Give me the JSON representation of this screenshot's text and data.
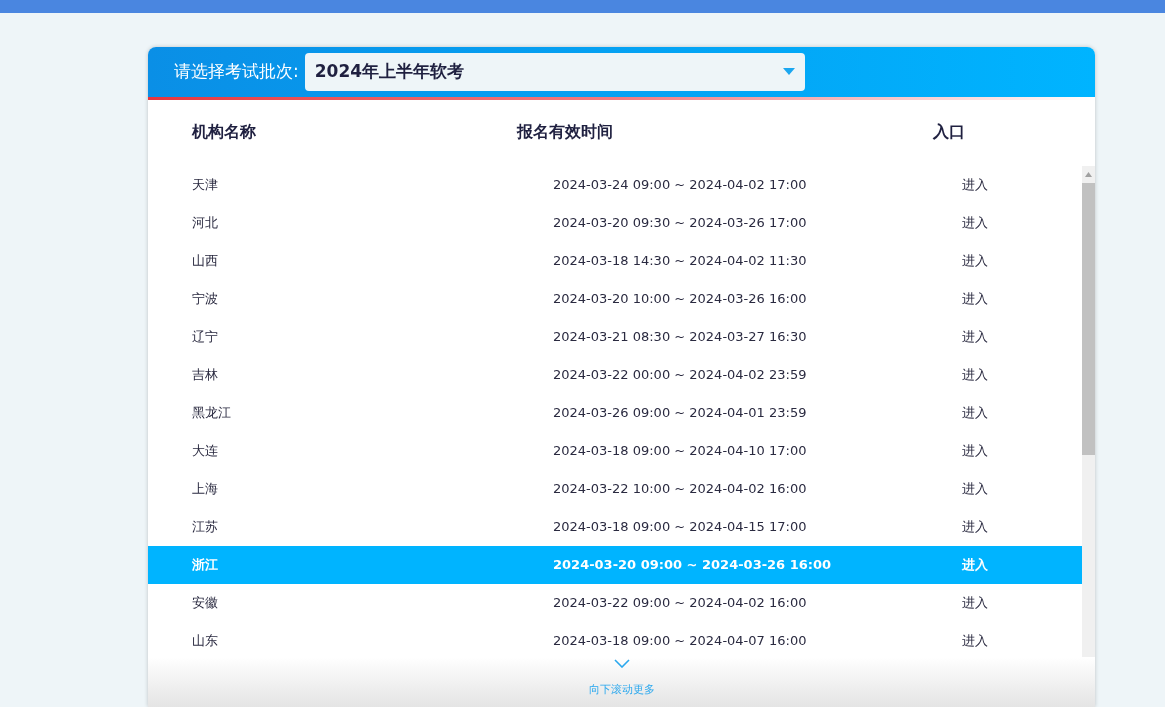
{
  "batch_select": {
    "label": "请选择考试批次:",
    "value": "2024年上半年软考"
  },
  "table": {
    "columns": [
      "机构名称",
      "报名有效时间",
      "入口"
    ],
    "rows": [
      {
        "name": "天津",
        "time": "2024-03-24 09:00 ~ 2024-04-02 17:00",
        "entry": "进入",
        "selected": false
      },
      {
        "name": "河北",
        "time": "2024-03-20 09:30 ~ 2024-03-26 17:00",
        "entry": "进入",
        "selected": false
      },
      {
        "name": "山西",
        "time": "2024-03-18 14:30 ~ 2024-04-02 11:30",
        "entry": "进入",
        "selected": false
      },
      {
        "name": "宁波",
        "time": "2024-03-20 10:00 ~ 2024-03-26 16:00",
        "entry": "进入",
        "selected": false
      },
      {
        "name": "辽宁",
        "time": "2024-03-21 08:30 ~ 2024-03-27 16:30",
        "entry": "进入",
        "selected": false
      },
      {
        "name": "吉林",
        "time": "2024-03-22 00:00 ~ 2024-04-02 23:59",
        "entry": "进入",
        "selected": false
      },
      {
        "name": "黑龙江",
        "time": "2024-03-26 09:00 ~ 2024-04-01 23:59",
        "entry": "进入",
        "selected": false
      },
      {
        "name": "大连",
        "time": "2024-03-18 09:00 ~ 2024-04-10 17:00",
        "entry": "进入",
        "selected": false
      },
      {
        "name": "上海",
        "time": "2024-03-22 10:00 ~ 2024-04-02 16:00",
        "entry": "进入",
        "selected": false
      },
      {
        "name": "江苏",
        "time": "2024-03-18 09:00 ~ 2024-04-15 17:00",
        "entry": "进入",
        "selected": false
      },
      {
        "name": "浙江",
        "time": "2024-03-20 09:00 ~ 2024-03-26 16:00",
        "entry": "进入",
        "selected": true
      },
      {
        "name": "安徽",
        "time": "2024-03-22 09:00 ~ 2024-04-02 16:00",
        "entry": "进入",
        "selected": false
      },
      {
        "name": "山东",
        "time": "2024-03-18 09:00 ~ 2024-04-07 16:00",
        "entry": "进入",
        "selected": false
      }
    ]
  },
  "scroll_hint": "向下滚动更多"
}
